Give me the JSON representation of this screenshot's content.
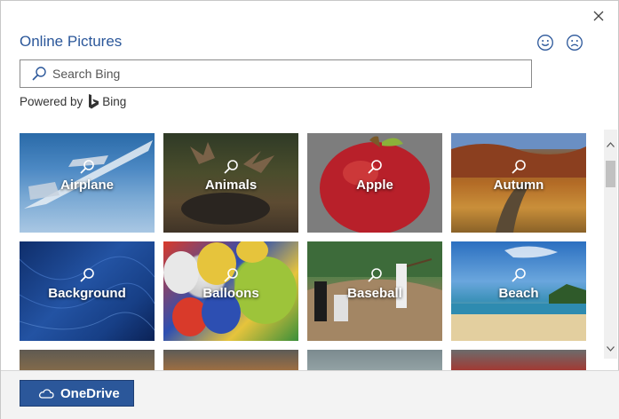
{
  "dialog": {
    "title": "Online Pictures",
    "close_icon": "close-icon",
    "feedback": {
      "smile_icon": "smile-icon",
      "frown_icon": "frown-icon"
    }
  },
  "search": {
    "placeholder": "Search Bing",
    "value": "",
    "icon": "search-icon"
  },
  "powered_by": {
    "label": "Powered by",
    "brand": "Bing",
    "icon": "bing-logo-icon"
  },
  "categories": [
    {
      "label": "Airplane"
    },
    {
      "label": "Animals"
    },
    {
      "label": "Apple"
    },
    {
      "label": "Autumn"
    },
    {
      "label": "Background"
    },
    {
      "label": "Balloons"
    },
    {
      "label": "Baseball"
    },
    {
      "label": "Beach"
    }
  ],
  "footer": {
    "onedrive_label": "OneDrive",
    "onedrive_icon": "cloud-icon"
  },
  "colors": {
    "accent": "#2b579a",
    "title": "#2b579a",
    "footer_bg": "#f3f3f3"
  }
}
